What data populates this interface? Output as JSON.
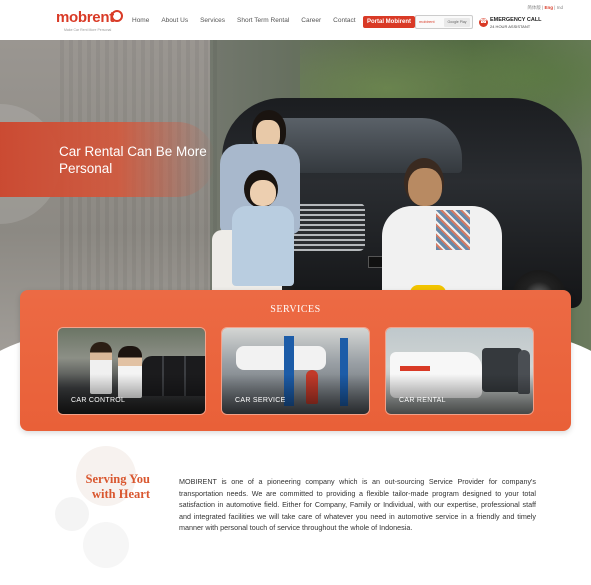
{
  "header": {
    "logo_text": "mobrent",
    "logo_tagline": "Make Car Rent More Personal",
    "nav": [
      "Home",
      "About Us",
      "Services",
      "Short Term Rental",
      "Career",
      "Contact"
    ],
    "portal_button": "Portal Mobirent",
    "store_badge_left": "mobirent",
    "store_badge_right": "Google Play",
    "language": {
      "zh": "简体版",
      "sep1": "|",
      "en": "Eng",
      "sep2": "|",
      "id": "Ind"
    },
    "emergency_line1": "EMERGENCY CALL",
    "emergency_line2": "24 HOUR ASSISTANT",
    "emergency_icon": "phone-icon"
  },
  "hero": {
    "title": "Car Rental Can Be More Personal"
  },
  "services": {
    "title": "SERVICES",
    "cards": [
      {
        "label": "CAR CONTROL"
      },
      {
        "label": "CAR SERVICE"
      },
      {
        "label": "CAR RENTAL"
      }
    ]
  },
  "about": {
    "title": "Serving You with Heart",
    "text": "MOBIRENT is one of a pioneering company which is an out-sourcing Service Provider for company's transportation needs. We are committed to providing a flexible tailor-made program designed to your total satisfaction in automotive field. Either for Company, Family or Individual, with our expertise, professional staff and integrated facilities we will take care of whatever you need in automotive service in a friendly and timely manner with personal touch of service throughout the whole of Indonesia."
  },
  "colors": {
    "brand": "#d93a26",
    "services_bg": "#ec6a44",
    "about_title": "#d9572f"
  }
}
